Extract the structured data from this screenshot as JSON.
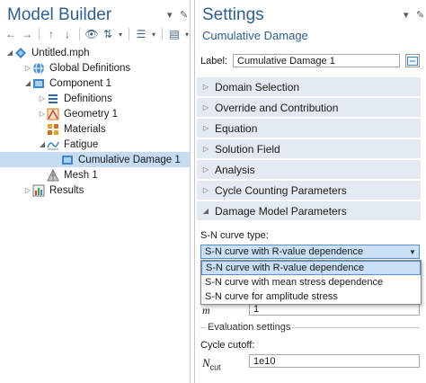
{
  "model_builder": {
    "title": "Model Builder",
    "tree": [
      {
        "label": "Untitled.mph",
        "icon": "model-file-icon",
        "twisty": "expanded"
      },
      {
        "label": "Global Definitions",
        "icon": "globe-icon",
        "twisty": "collapsed"
      },
      {
        "label": "Component 1",
        "icon": "component-icon",
        "twisty": "expanded"
      },
      {
        "label": "Definitions",
        "icon": "definitions-icon",
        "twisty": "collapsed"
      },
      {
        "label": "Geometry 1",
        "icon": "geometry-icon",
        "twisty": "collapsed"
      },
      {
        "label": "Materials",
        "icon": "materials-icon",
        "twisty": ""
      },
      {
        "label": "Fatigue",
        "icon": "fatigue-icon",
        "twisty": "expanded"
      },
      {
        "label": "Cumulative Damage 1",
        "icon": "cumulative-damage-icon",
        "twisty": ""
      },
      {
        "label": "Mesh 1",
        "icon": "mesh-icon",
        "twisty": ""
      },
      {
        "label": "Results",
        "icon": "results-icon",
        "twisty": "collapsed"
      }
    ]
  },
  "settings": {
    "title": "Settings",
    "subtitle": "Cumulative Damage",
    "label_caption": "Label:",
    "label_value": "Cumulative Damage 1",
    "sections": [
      "Domain Selection",
      "Override and Contribution",
      "Equation",
      "Solution Field",
      "Analysis",
      "Cycle Counting Parameters",
      "Damage Model Parameters"
    ],
    "sn_curve_type_label": "S-N curve type:",
    "sn_curve_selected": "S-N curve with R-value dependence",
    "sn_curve_options": [
      "S-N curve with R-value dependence",
      "S-N curve with mean stress dependence",
      "S-N curve for amplitude stress"
    ],
    "m_symbol": "m",
    "m_value": "1",
    "evaluation_settings": "Evaluation settings",
    "cycle_cutoff_label": "Cycle cutoff:",
    "n_symbol": "N",
    "n_subscript": "cut",
    "n_value": "1e10"
  },
  "colors": {
    "accent": "#2f5f8f",
    "selection": "#c5dcf2",
    "section_bg": "#e3eaf1"
  }
}
